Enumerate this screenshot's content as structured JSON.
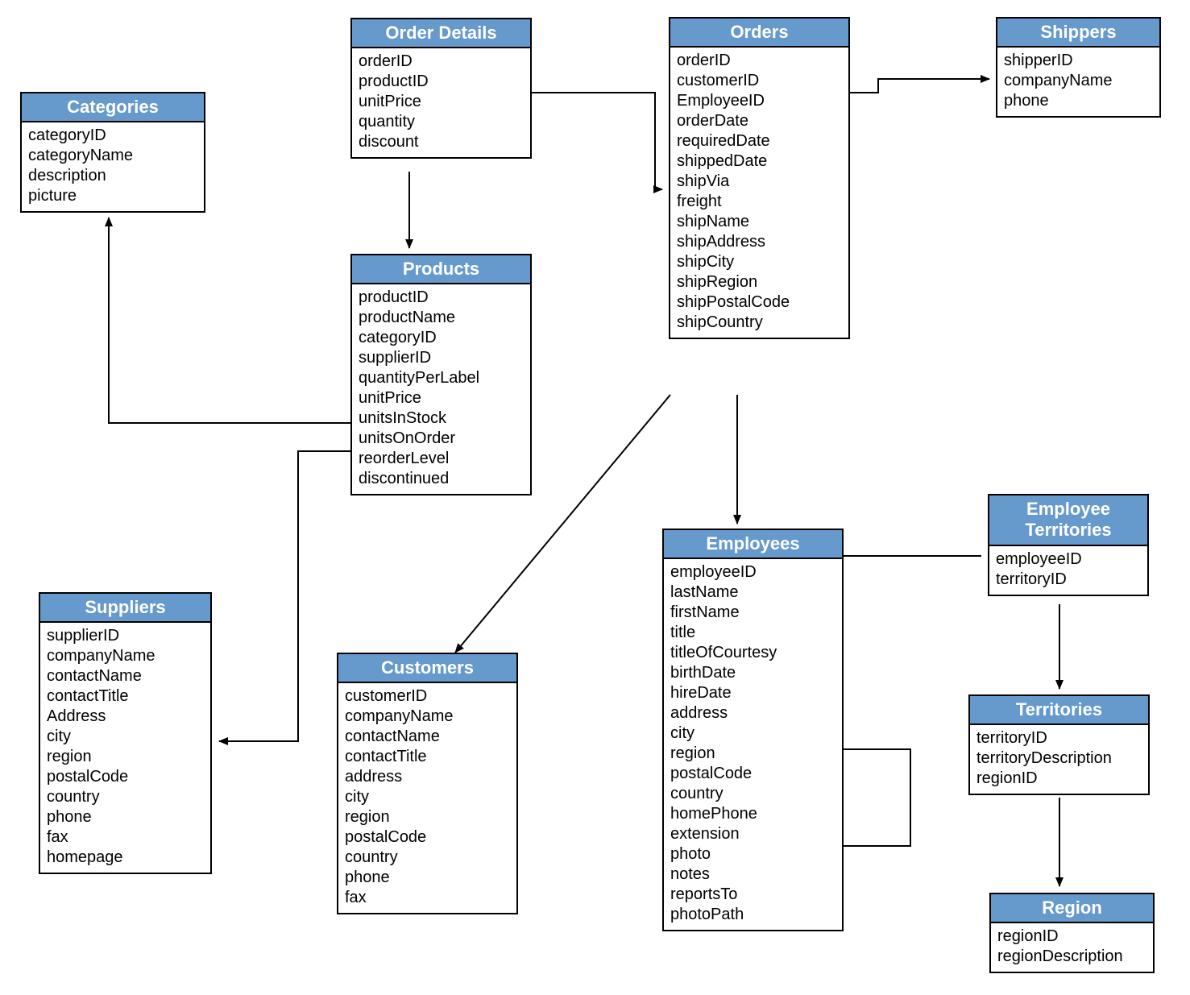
{
  "entities": {
    "categories": {
      "title": "Categories",
      "fields": [
        "categoryID",
        "categoryName",
        "description",
        "picture"
      ]
    },
    "orderDetails": {
      "title": "Order Details",
      "fields": [
        "orderID",
        "productID",
        "unitPrice",
        "quantity",
        "discount"
      ]
    },
    "products": {
      "title": "Products",
      "fields": [
        "productID",
        "productName",
        "categoryID",
        "supplierID",
        "quantityPerLabel",
        "unitPrice",
        "unitsInStock",
        "unitsOnOrder",
        "reorderLevel",
        "discontinued"
      ]
    },
    "orders": {
      "title": "Orders",
      "fields": [
        "orderID",
        "customerID",
        "EmployeeID",
        "orderDate",
        "requiredDate",
        "shippedDate",
        "shipVia",
        "freight",
        "shipName",
        "shipAddress",
        "shipCity",
        "shipRegion",
        "shipPostalCode",
        "shipCountry"
      ]
    },
    "shippers": {
      "title": "Shippers",
      "fields": [
        "shipperID",
        "companyName",
        "phone"
      ]
    },
    "suppliers": {
      "title": "Suppliers",
      "fields": [
        "supplierID",
        "companyName",
        "contactName",
        "contactTitle",
        "Address",
        "city",
        "region",
        "postalCode",
        "country",
        "phone",
        "fax",
        "homepage"
      ]
    },
    "customers": {
      "title": "Customers",
      "fields": [
        "customerID",
        "companyName",
        "contactName",
        "contactTitle",
        "address",
        "city",
        "region",
        "postalCode",
        "country",
        "phone",
        "fax"
      ]
    },
    "employees": {
      "title": "Employees",
      "fields": [
        "employeeID",
        "lastName",
        "firstName",
        "title",
        "titleOfCourtesy",
        "birthDate",
        "hireDate",
        "address",
        "city",
        "region",
        "postalCode",
        "country",
        "homePhone",
        "extension",
        "photo",
        "notes",
        "reportsTo",
        "photoPath"
      ]
    },
    "employeeTerritories": {
      "title": "Employee\nTerritories",
      "fields": [
        "employeeID",
        "territoryID"
      ]
    },
    "territories": {
      "title": "Territories",
      "fields": [
        "territoryID",
        "territoryDescription",
        "regionID"
      ]
    },
    "region": {
      "title": "Region",
      "fields": [
        "regionID",
        "regionDescription"
      ]
    }
  }
}
